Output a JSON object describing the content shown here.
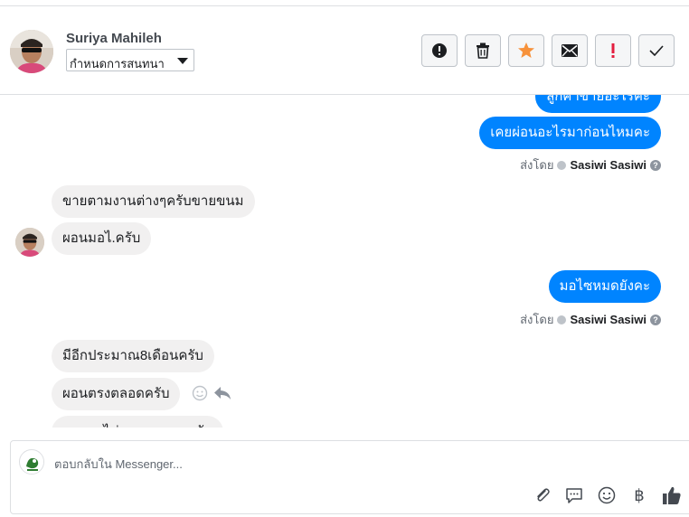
{
  "header": {
    "contact_name": "Suriya Mahileh",
    "label_select_value": "กำหนดการสนทนา"
  },
  "toolbar": {
    "buttons": [
      "block-icon",
      "trash-icon",
      "star-icon",
      "envelope-icon",
      "exclamation-icon",
      "checkmark-icon"
    ]
  },
  "messages": [
    {
      "direction": "outgoing",
      "text": "ลูกค้าขายอะไรคะ"
    },
    {
      "direction": "outgoing",
      "text": "เคยผ่อนอะไรมาก่อนไหมคะ"
    },
    {
      "direction": "incoming",
      "text": "ขายตามงานต่างๆครับขายขนม"
    },
    {
      "direction": "incoming",
      "text": "ผอนมอไ.ครับ"
    },
    {
      "direction": "outgoing",
      "text": "มอไซหมดยังคะ"
    },
    {
      "direction": "incoming",
      "text": "มีอีกประมาณ8เดือนครับ"
    },
    {
      "direction": "incoming",
      "text": "ผอนตรงตลอดครับ"
    },
    {
      "direction": "incoming",
      "text": "ผอนรถไม่เคยขาดเลยครับ"
    }
  ],
  "sent_by": {
    "prefix": "ส่งโดย",
    "agent": "Sasiwi Sasiwi"
  },
  "composer": {
    "placeholder": "ตอบกลับใน Messenger...",
    "currency_symbol": "฿"
  },
  "colors": {
    "outgoing_bubble": "#0084ff",
    "incoming_bubble": "#f1f0f0",
    "star_accent": "#f7923b",
    "alert_red": "#e41e3f"
  }
}
